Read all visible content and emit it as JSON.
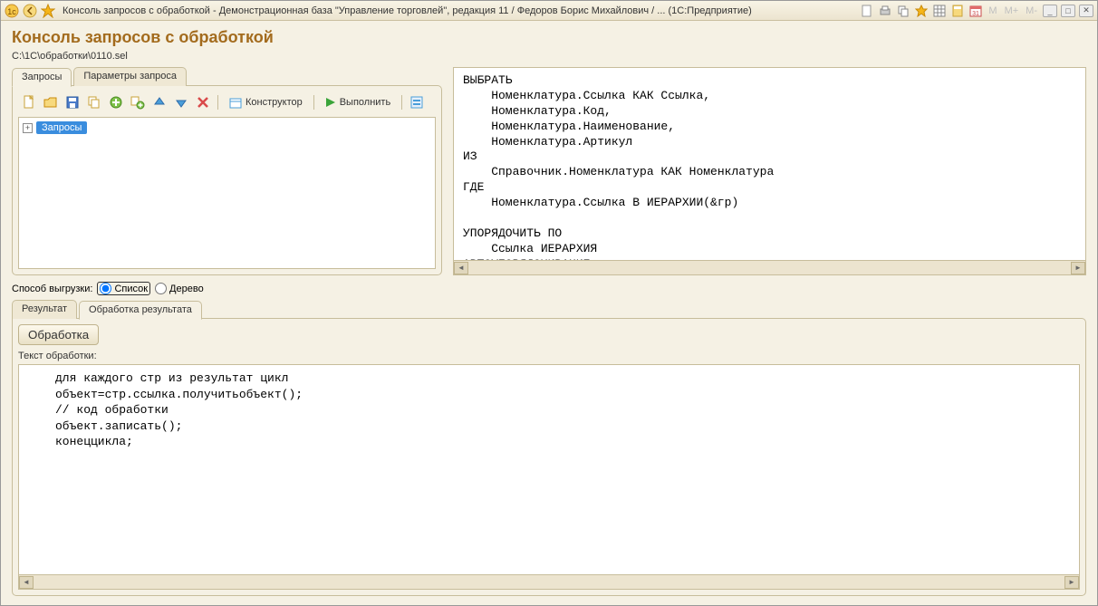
{
  "window": {
    "title": "Консоль запросов с обработкой - Демонстрационная база \"Управление торговлей\", редакция 11 / Федоров Борис Михайлович / ...   (1С:Предприятие)",
    "mem_buttons": [
      "M",
      "M+",
      "M-"
    ]
  },
  "page": {
    "title": "Консоль запросов с обработкой",
    "path": "C:\\1C\\обработки\\0110.sel"
  },
  "tabs_top": {
    "queries": "Запросы",
    "params": "Параметры запроса"
  },
  "toolbar": {
    "constructor": "Конструктор",
    "execute": "Выполнить"
  },
  "tree": {
    "root": "Запросы"
  },
  "query_text": "ВЫБРАТЬ\n    Номенклатура.Ссылка КАК Ссылка,\n    Номенклатура.Код,\n    Номенклатура.Наименование,\n    Номенклатура.Артикул\nИЗ\n    Справочник.Номенклатура КАК Номенклатура\nГДЕ\n    Номенклатура.Ссылка В ИЕРАРХИИ(&гр)\n\nУПОРЯДОЧИТЬ ПО\n    Ссылка ИЕРАРХИЯ\nАВТОУПОРЯДОЧИВАНИЕ",
  "output": {
    "label": "Способ выгрузки:",
    "list": "Список",
    "tree": "Дерево"
  },
  "tabs_bottom": {
    "result": "Результат",
    "processing": "Обработка результата"
  },
  "processing": {
    "button": "Обработка",
    "label": "Текст обработки:",
    "code": "для каждого стр из результат цикл\nобъект=стр.ссылка.получитьобъект();\n// код обработки\nобъект.записать();\nконеццикла;"
  }
}
